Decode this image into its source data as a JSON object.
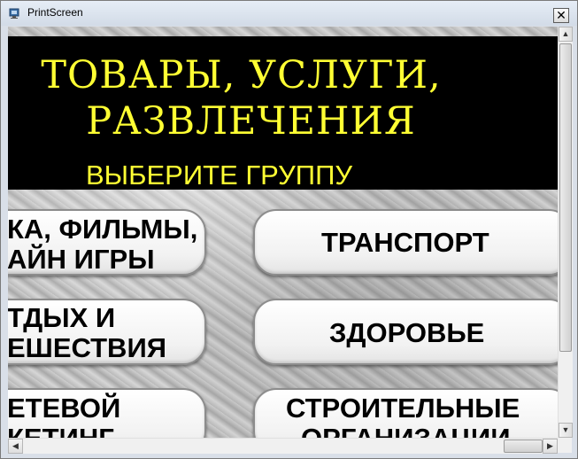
{
  "window": {
    "title": "PrintScreen",
    "close_label": "✕"
  },
  "header": {
    "line1": "ТОВАРЫ, УСЛУГИ,",
    "line2": "РАЗВЛЕЧЕНИЯ"
  },
  "prompt": "ВЫБЕРИТЕ ГРУППУ",
  "left_buttons": [
    {
      "line1": "КА, ФИЛЬМЫ,",
      "line2": "АЙН ИГРЫ"
    },
    {
      "line1": "ТДЫХ И",
      "line2": "ЕШЕСТВИЯ"
    },
    {
      "line1": "ЕТЕВОЙ",
      "line2": "КЕТИНГ"
    }
  ],
  "right_buttons": [
    {
      "label": "ТРАНСПОРТ"
    },
    {
      "label": "ЗДОРОВЬЕ"
    },
    {
      "line1": "СТРОИТЕЛЬНЫЕ",
      "line2": "ОРГАНИЗАЦИИ"
    }
  ],
  "scroll": {
    "up": "▲",
    "down": "▼",
    "left": "◀",
    "right": "▶"
  }
}
